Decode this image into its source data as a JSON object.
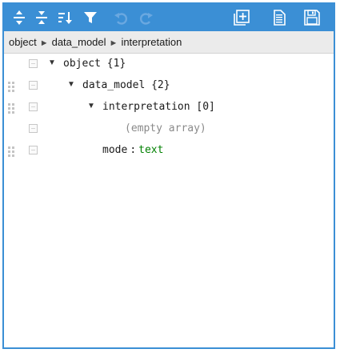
{
  "toolbar": {
    "items": [
      {
        "icon": "expand-all-icon",
        "enabled": true
      },
      {
        "icon": "collapse-all-icon",
        "enabled": true
      },
      {
        "icon": "sort-icon",
        "enabled": true
      },
      {
        "icon": "filter-icon",
        "enabled": true
      },
      {
        "icon": "undo-icon",
        "enabled": false
      },
      {
        "icon": "redo-icon",
        "enabled": false
      },
      {
        "icon": "add-icon",
        "enabled": true
      },
      {
        "icon": "copy-icon",
        "enabled": true
      },
      {
        "icon": "save-icon",
        "enabled": true
      }
    ]
  },
  "navbar": {
    "path": [
      "object",
      "data_model",
      "interpretation"
    ],
    "separator": "►"
  },
  "tree": {
    "rows": [
      {
        "key": "object",
        "meta": "{1}"
      },
      {
        "key": "data_model",
        "meta": "{2}"
      },
      {
        "key": "interpretation",
        "meta": "[0]"
      },
      {
        "placeholder": "(empty array)"
      },
      {
        "key": "mode",
        "separator": ":",
        "value": "text"
      }
    ]
  },
  "colors": {
    "accent": "#3b8fd5",
    "string_value": "#008000",
    "muted_text": "#8a8a8a"
  }
}
